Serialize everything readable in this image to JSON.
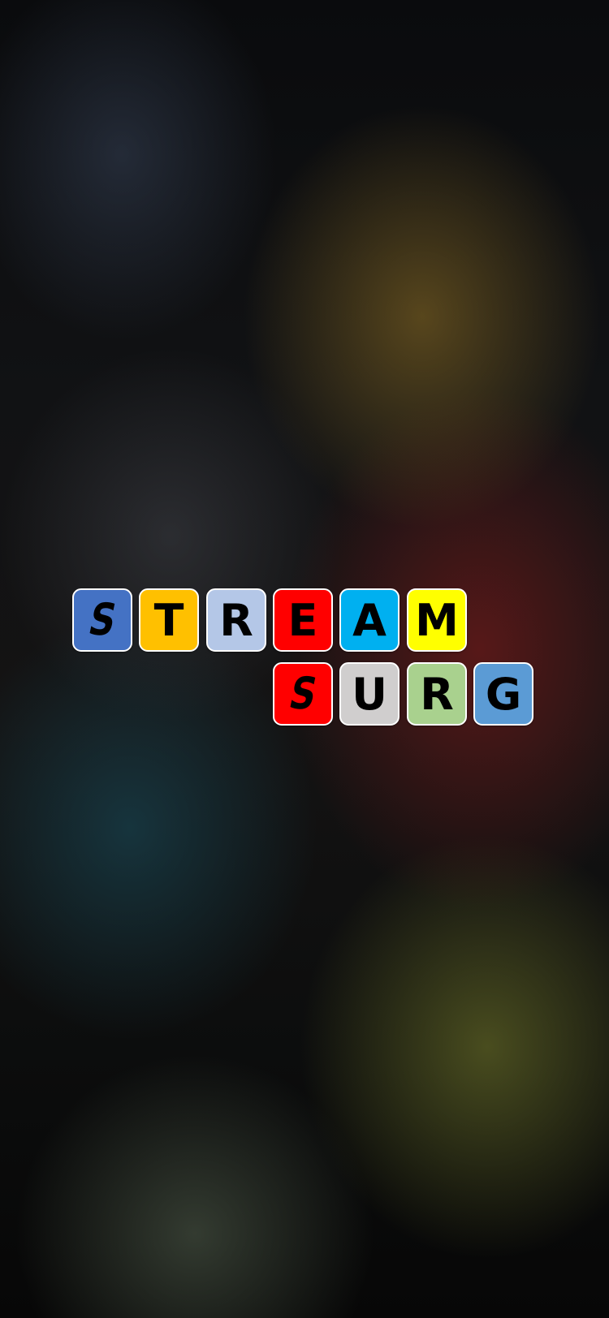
{
  "logo": {
    "row1": [
      {
        "letter": "S",
        "color": "#4472c4"
      },
      {
        "letter": "T",
        "color": "#ffc000"
      },
      {
        "letter": "R",
        "color": "#b4c7e7"
      },
      {
        "letter": "E",
        "color": "#ff0000"
      },
      {
        "letter": "A",
        "color": "#00b0f0"
      },
      {
        "letter": "M",
        "color": "#ffff00"
      }
    ],
    "row2": [
      {
        "letter": "S",
        "color": "#ff0000"
      },
      {
        "letter": "U",
        "color": "#d0cece"
      },
      {
        "letter": "R",
        "color": "#a9d18e"
      },
      {
        "letter": "G",
        "color": "#5b9bd5"
      }
    ]
  }
}
